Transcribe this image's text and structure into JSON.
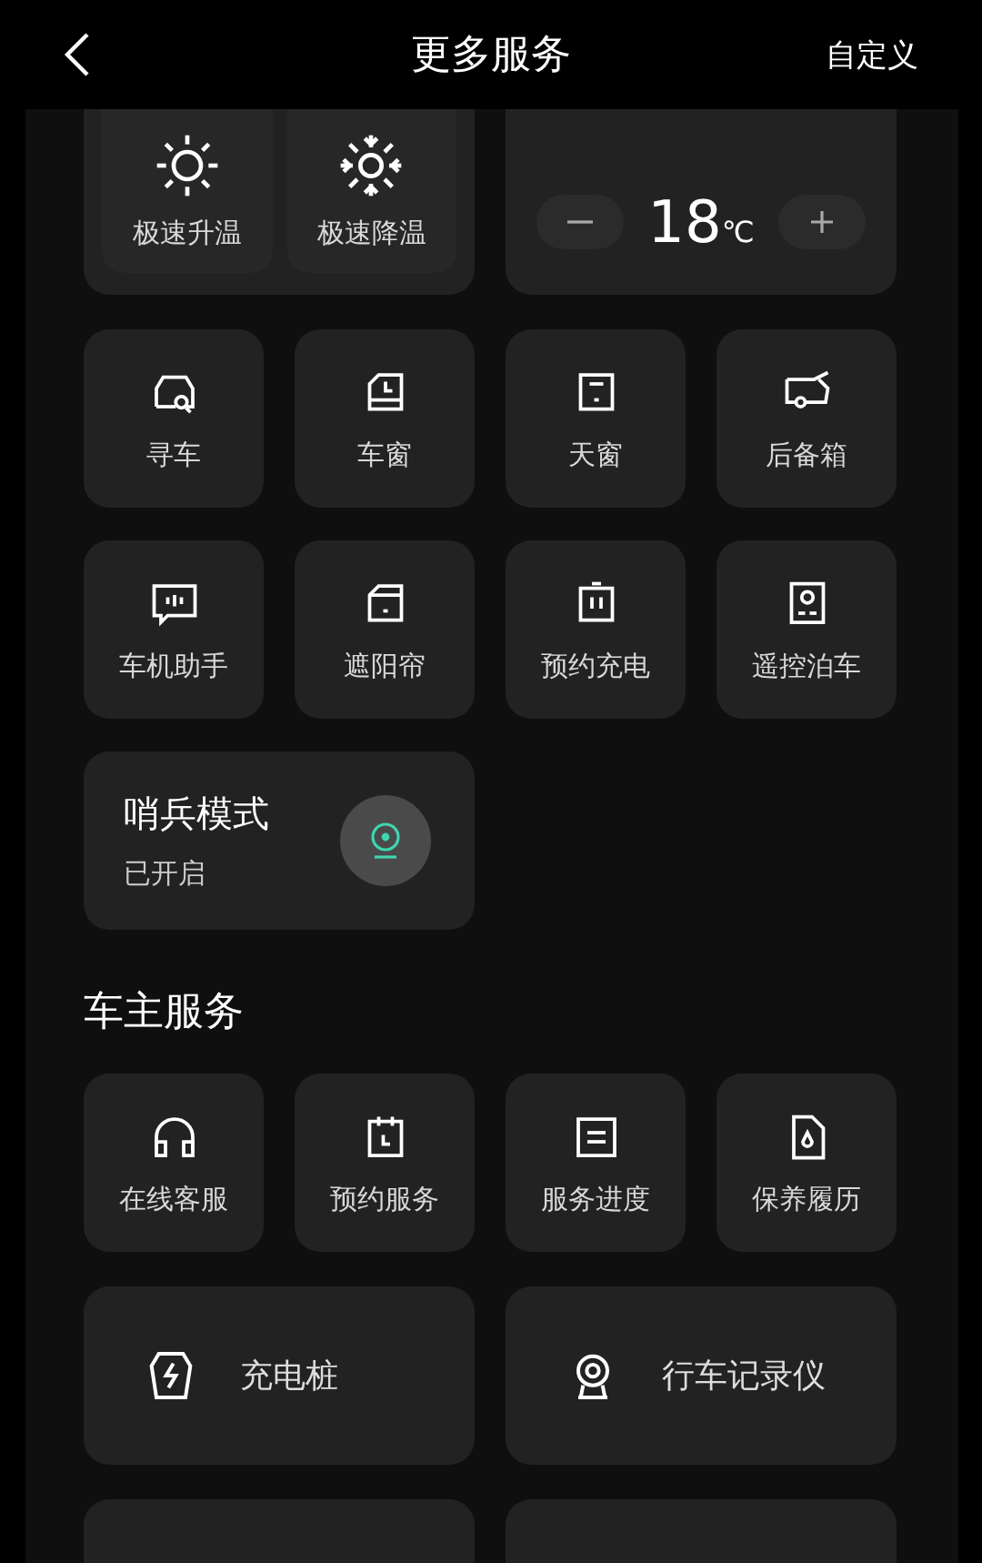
{
  "header": {
    "title": "更多服务",
    "action": "自定义"
  },
  "climate": {
    "tiles": [
      {
        "label": "极速升温"
      },
      {
        "label": "极速降温"
      }
    ],
    "temperature": {
      "value": "18",
      "unit": "℃"
    }
  },
  "controls": [
    {
      "label": "寻车"
    },
    {
      "label": "车窗"
    },
    {
      "label": "天窗"
    },
    {
      "label": "后备箱"
    },
    {
      "label": "车机助手"
    },
    {
      "label": "遮阳帘"
    },
    {
      "label": "预约充电"
    },
    {
      "label": "遥控泊车"
    }
  ],
  "sentry": {
    "title": "哨兵模式",
    "status": "已开启",
    "on": true
  },
  "owner_services": {
    "title": "车主服务",
    "tiles": [
      {
        "label": "在线客服"
      },
      {
        "label": "预约服务"
      },
      {
        "label": "服务进度"
      },
      {
        "label": "保养履历"
      }
    ],
    "wide_cards": [
      {
        "label": "充电桩"
      },
      {
        "label": "行车记录仪"
      }
    ]
  }
}
